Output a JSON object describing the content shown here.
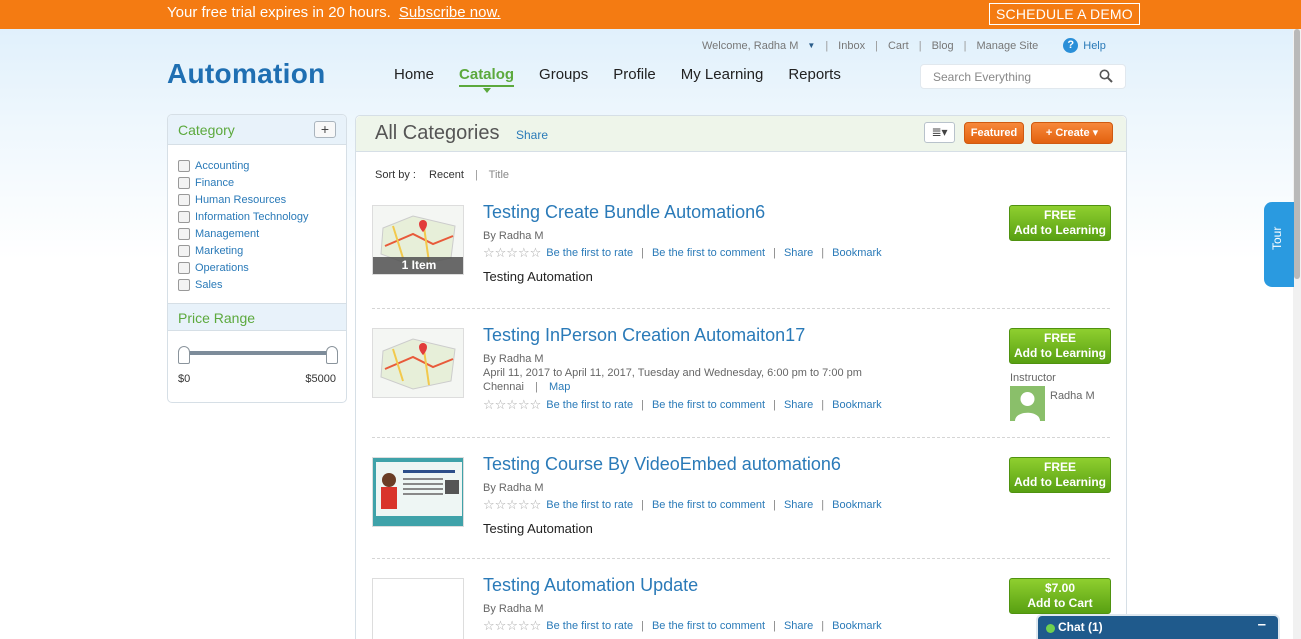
{
  "banner": {
    "text": "Your free trial expires in 20 hours.",
    "link": "Subscribe now.",
    "demo_button": "SCHEDULE A DEMO"
  },
  "header": {
    "welcome": "Welcome, Radha M",
    "links": [
      "Inbox",
      "Cart",
      "Blog",
      "Manage Site"
    ],
    "help": "Help",
    "logo": "Automation",
    "nav": [
      "Home",
      "Catalog",
      "Groups",
      "Profile",
      "My Learning",
      "Reports"
    ],
    "active_nav": "Catalog",
    "search_placeholder": "Search Everything"
  },
  "sidebar": {
    "category_title": "Category",
    "add_label": "+",
    "categories": [
      "Accounting",
      "Finance",
      "Human Resources",
      "Information Technology",
      "Management",
      "Marketing",
      "Operations",
      "Sales"
    ],
    "price_title": "Price Range",
    "price_min": "$0",
    "price_max": "$5000"
  },
  "main": {
    "title": "All Categories",
    "share": "Share",
    "view_icon": "≣▾",
    "featured": "Featured",
    "create": "+ Create ▾",
    "sort_label": "Sort by :",
    "sort_current": "Recent",
    "sort_other": "Title",
    "action_labels": {
      "rate": "Be the first to rate",
      "comment": "Be the first to comment",
      "share": "Share",
      "bookmark": "Bookmark"
    },
    "stars": "☆☆☆☆☆",
    "items": [
      {
        "title": "Testing Create Bundle Automation6",
        "by": "By Radha M",
        "badge": "1 Item",
        "desc": "Testing Automation",
        "price_line1": "FREE",
        "price_line2": "Add to Learning"
      },
      {
        "title": "Testing InPerson Creation Automaiton17",
        "by": "By Radha M",
        "schedule": "April 11, 2017 to April 11, 2017, Tuesday and Wednesday, 6:00 pm to 7:00 pm",
        "location": "Chennai",
        "map": "Map",
        "price_line1": "FREE",
        "price_line2": "Add to Learning",
        "instructor_label": "Instructor",
        "instructor_name": "Radha M"
      },
      {
        "title": "Testing Course By VideoEmbed automation6",
        "by": "By Radha M",
        "desc": "Testing Automation",
        "price_line1": "FREE",
        "price_line2": "Add to Learning"
      },
      {
        "title": "Testing Automation Update",
        "by": "By Radha M",
        "price_line1": "$7.00",
        "price_line2": "Add to Cart"
      }
    ]
  },
  "tour": "Tour",
  "chat": {
    "label": "Chat  (1)",
    "minimize": "–"
  }
}
